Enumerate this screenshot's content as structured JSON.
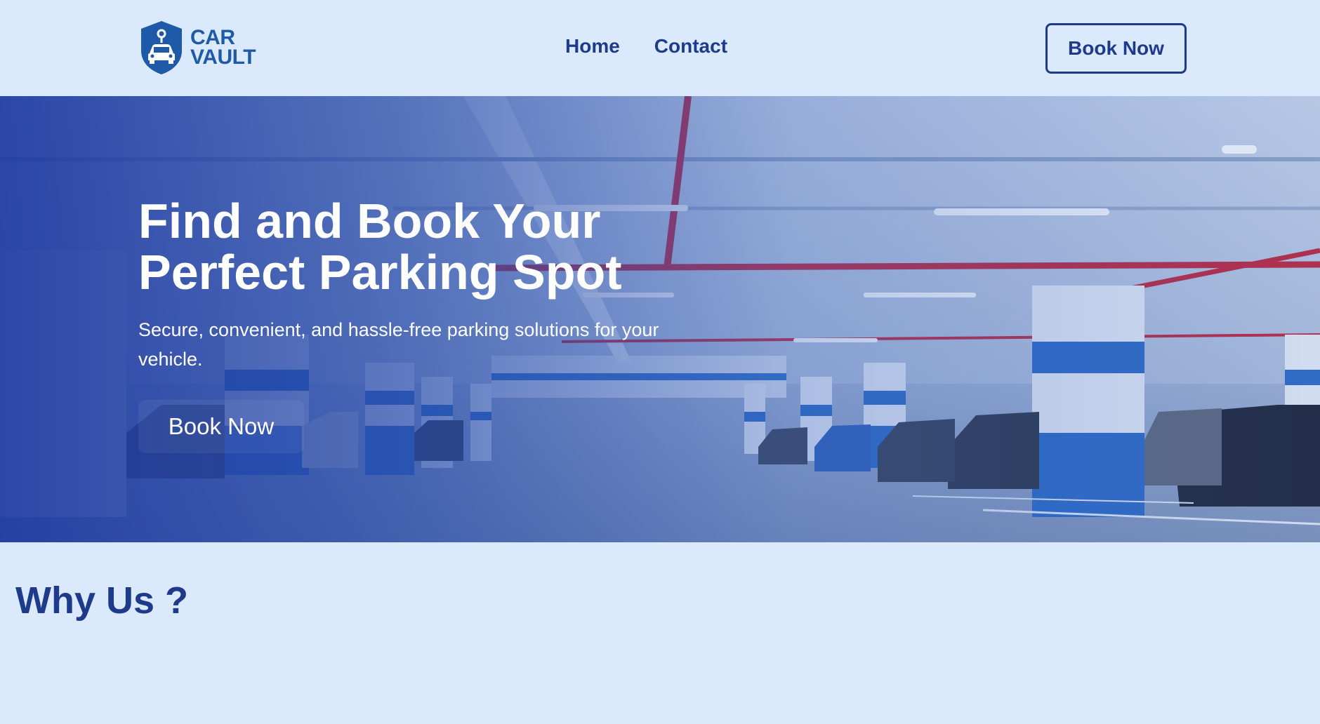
{
  "brand": {
    "line1": "CAR",
    "line2": "VAULT",
    "color": "#1e5aa8"
  },
  "nav": {
    "items": [
      {
        "label": "Home"
      },
      {
        "label": "Contact"
      }
    ]
  },
  "header": {
    "cta_label": "Book Now"
  },
  "hero": {
    "title": "Find and Book Your Perfect Parking Spot",
    "subtitle": "Secure, convenient, and hassle-free parking solutions for your vehicle.",
    "cta_label": "Book Now",
    "background": "parking-garage-image"
  },
  "why": {
    "title": "Why Us ?"
  },
  "colors": {
    "page_bg": "#dbe9fd",
    "primary": "#1e3a8a",
    "hero_overlay": "#1e3aa0"
  }
}
